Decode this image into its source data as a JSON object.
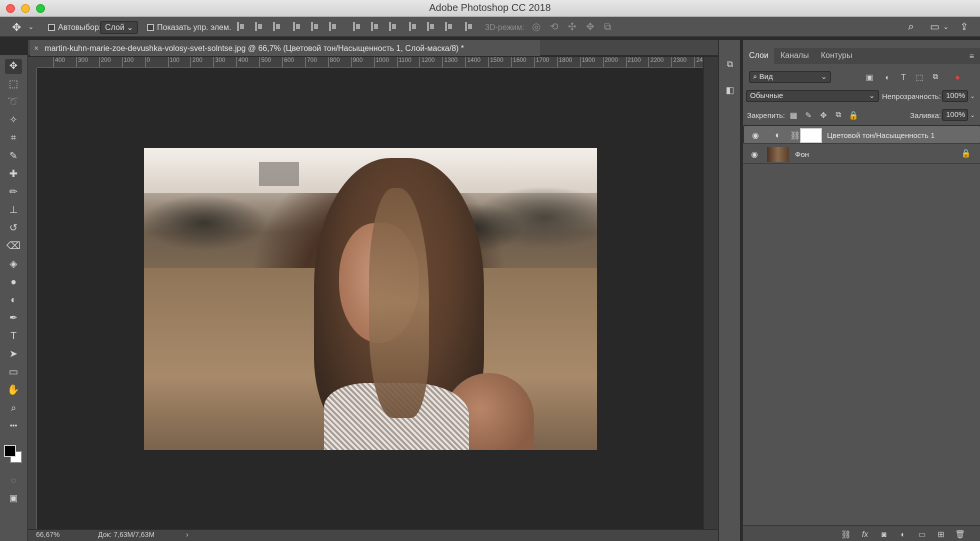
{
  "window": {
    "title": "Adobe Photoshop CC 2018"
  },
  "options_bar": {
    "autoselect_label": "Автовыбор:",
    "autoselect_value": "Слой",
    "show_controls_label": "Показать упр. элем.",
    "mode_3d_label": "3D-режим:"
  },
  "document": {
    "tab_title": "martin-kuhn-marie-zoe-devushka-volosy-svet-solntse.jpg @ 66,7% (Цветовой тон/Насыщенность 1, Слой-маска/8) *",
    "close_symbol": "×"
  },
  "ruler": {
    "ticks": [
      "400",
      "300",
      "200",
      "100",
      "0",
      "100",
      "200",
      "300",
      "400",
      "500",
      "600",
      "700",
      "800",
      "900",
      "1000",
      "1100",
      "1200",
      "1300",
      "1400",
      "1500",
      "1600",
      "1700",
      "1800",
      "1900",
      "2000",
      "2100",
      "2200",
      "2300",
      "2400"
    ]
  },
  "status": {
    "zoom": "66,67%",
    "doc_size": "Док: 7,63M/7,63M",
    "arrow": "›"
  },
  "layers_panel": {
    "tabs": [
      "Слои",
      "Каналы",
      "Контуры"
    ],
    "filter_label": "Вид",
    "blend_mode": "Обычные",
    "opacity_label": "Непрозрачность:",
    "opacity_value": "100%",
    "lock_label": "Закрепить:",
    "fill_label": "Заливка:",
    "fill_value": "100%",
    "layers": [
      {
        "name": "Цветовой тон/Насыщенность 1",
        "selected": true
      },
      {
        "name": "Фон",
        "selected": false
      }
    ]
  },
  "icons": {
    "move": "✥",
    "marquee": "⬚",
    "lasso": "➰",
    "wand": "✧",
    "crop": "⌗",
    "eyedropper": "✎",
    "heal": "✚",
    "brush": "✏",
    "stamp": "⊥",
    "history": "↺",
    "eraser": "⌫",
    "bucket": "◈",
    "blur": "●",
    "dodge": "◐",
    "pen": "✒",
    "type": "T",
    "path": "➤",
    "rect": "▭",
    "hand": "✋",
    "zoom": "⌕",
    "more": "•••",
    "eye": "◉",
    "lock": "🔒"
  },
  "colors": {
    "accent": "#535353",
    "selected_layer": "#696969"
  }
}
